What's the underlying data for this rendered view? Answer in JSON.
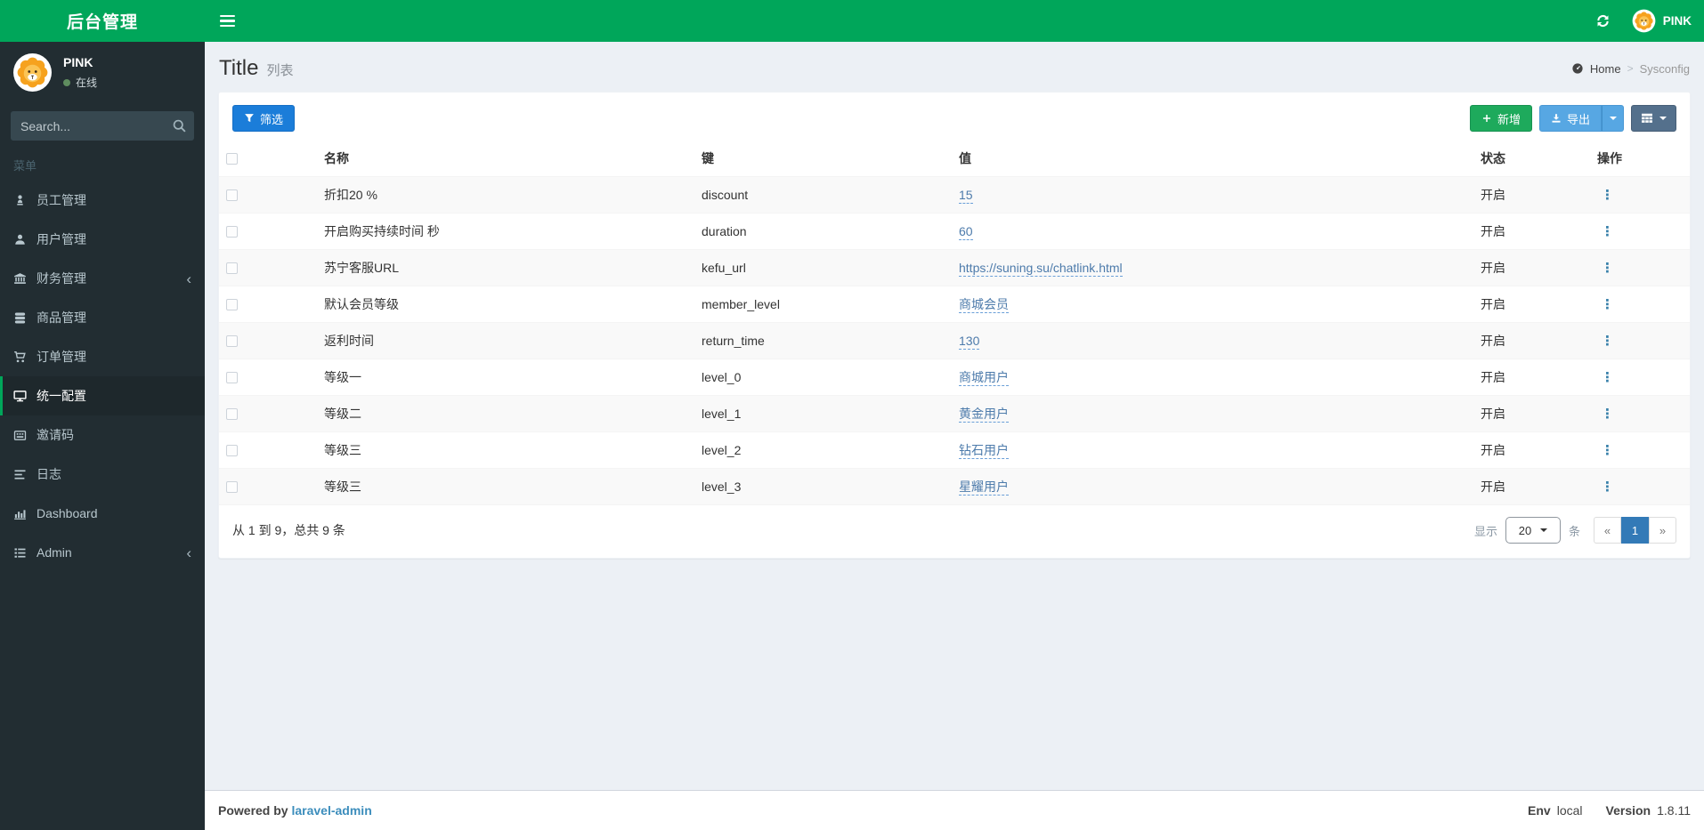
{
  "app": {
    "title": "后台管理",
    "user_name": "PINK",
    "user_status": "在线"
  },
  "sidebar": {
    "search_placeholder": "Search...",
    "menu_header": "菜单",
    "items": [
      {
        "label": "员工管理",
        "icon": "staff-icon",
        "expandable": false,
        "active": false
      },
      {
        "label": "用户管理",
        "icon": "user-icon",
        "expandable": false,
        "active": false
      },
      {
        "label": "财务管理",
        "icon": "bank-icon",
        "expandable": true,
        "active": false
      },
      {
        "label": "商品管理",
        "icon": "database-icon",
        "expandable": false,
        "active": false
      },
      {
        "label": "订单管理",
        "icon": "cart-icon",
        "expandable": false,
        "active": false
      },
      {
        "label": "统一配置",
        "icon": "desktop-icon",
        "expandable": false,
        "active": true
      },
      {
        "label": "邀请码",
        "icon": "keyboard-icon",
        "expandable": false,
        "active": false
      },
      {
        "label": "日志",
        "icon": "align-left-icon",
        "expandable": false,
        "active": false
      },
      {
        "label": "Dashboard",
        "icon": "bar-chart-icon",
        "expandable": false,
        "active": false
      },
      {
        "label": "Admin",
        "icon": "list-icon",
        "expandable": true,
        "active": false
      }
    ]
  },
  "page": {
    "title": "Title",
    "subtitle": "列表",
    "breadcrumb_home": "Home",
    "breadcrumb_sep": ">",
    "breadcrumb_current": "Sysconfig"
  },
  "toolbar": {
    "filter_label": "筛选",
    "add_label": "新增",
    "export_label": "导出"
  },
  "table": {
    "headers": {
      "name": "名称",
      "key": "键",
      "value": "值",
      "status": "状态",
      "action": "操作"
    },
    "action_icon": "⋮",
    "rows": [
      {
        "name": "折扣20 %",
        "key": "discount",
        "value": "15",
        "status": "开启"
      },
      {
        "name": "开启购买持续时间 秒",
        "key": "duration",
        "value": "60",
        "status": "开启"
      },
      {
        "name": "苏宁客服URL",
        "key": "kefu_url",
        "value": "https://suning.su/chatlink.html",
        "status": "开启"
      },
      {
        "name": "默认会员等级",
        "key": "member_level",
        "value": "商城会员",
        "status": "开启"
      },
      {
        "name": "返利时间",
        "key": "return_time",
        "value": "130",
        "status": "开启"
      },
      {
        "name": "等级一",
        "key": "level_0",
        "value": "商城用户",
        "status": "开启"
      },
      {
        "name": "等级二",
        "key": "level_1",
        "value": "黄金用户",
        "status": "开启"
      },
      {
        "name": "等级三",
        "key": "level_2",
        "value": "钻石用户",
        "status": "开启"
      },
      {
        "name": "等级三",
        "key": "level_3",
        "value": "星耀用户",
        "status": "开启"
      }
    ]
  },
  "pagination": {
    "summary": "从 1 到 9，总共 9 条",
    "show_label": "显示",
    "per_page": "20",
    "unit_label": "条",
    "prev": "«",
    "current_page": "1",
    "next": "»"
  },
  "footer": {
    "powered_by": "Powered by",
    "powered_link": "laravel-admin",
    "env_label": "Env",
    "env_value": "local",
    "version_label": "Version",
    "version_value": "1.8.11"
  },
  "colors": {
    "brand_green": "#00a65a",
    "sidebar_dark": "#222d32",
    "filter_blue": "#1b7dd9",
    "add_green": "#1eaa5c",
    "export_blue": "#57a7e3",
    "grid_slate": "#54708c",
    "active_page_blue": "#337ab7",
    "value_link_blue": "#4d7bab",
    "footer_link_blue": "#3c8dbc"
  }
}
